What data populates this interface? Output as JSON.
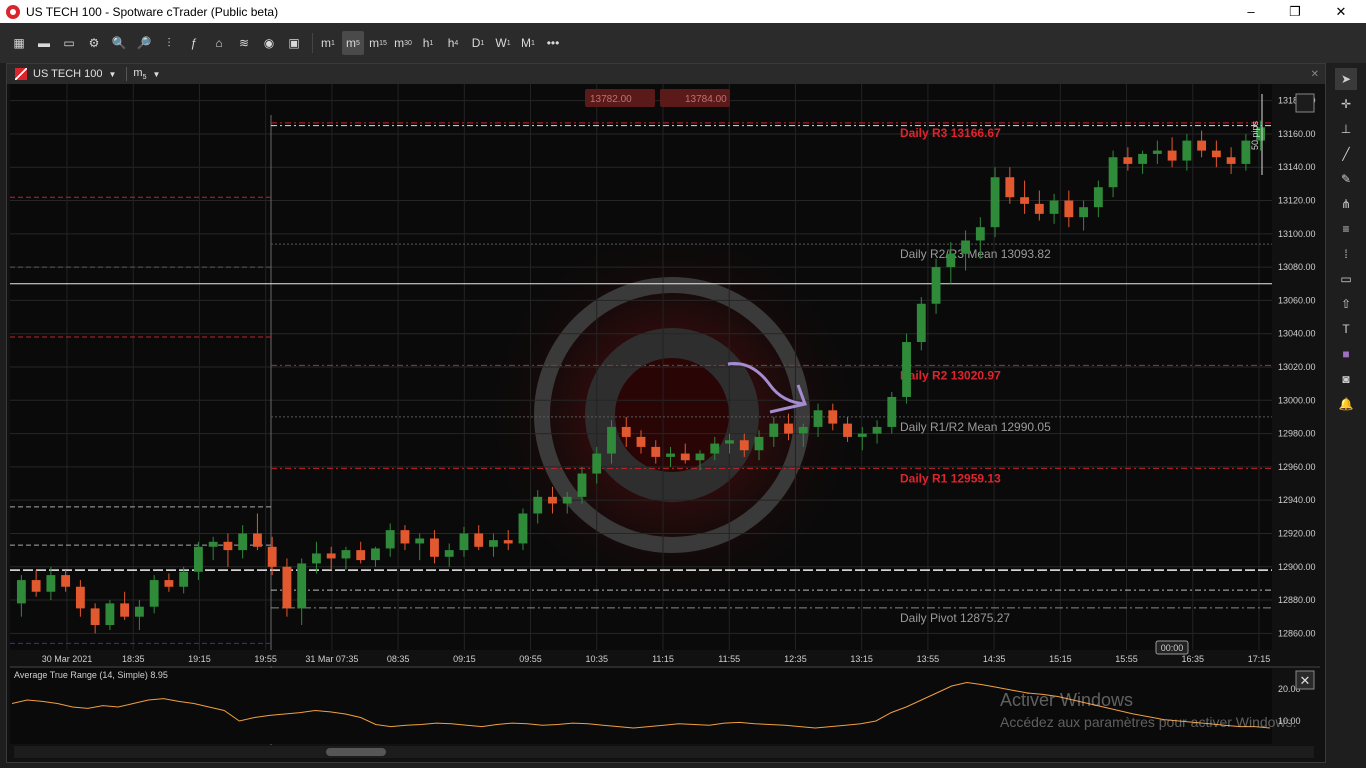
{
  "window": {
    "title": "US TECH 100 - Spotware cTrader (Public beta)",
    "minimize": "–",
    "maximize": "❐",
    "close": "✕"
  },
  "toolbar": {
    "icons": [
      "layout-icon",
      "single-chart-icon",
      "multi-chart-icon",
      "chart-settings-icon",
      "zoom-in-icon",
      "zoom-out-icon",
      "chart-type-icon",
      "indicators-icon",
      "cbots-icon",
      "layers-icon",
      "eye-icon",
      "chart-screenshot-icon"
    ],
    "timeframes": [
      {
        "label": "m",
        "sub": "1"
      },
      {
        "label": "m",
        "sub": "5",
        "active": true
      },
      {
        "label": "m",
        "sub": "15"
      },
      {
        "label": "m",
        "sub": "30"
      },
      {
        "label": "h",
        "sub": "1"
      },
      {
        "label": "h",
        "sub": "4"
      },
      {
        "label": "D",
        "sub": "1"
      },
      {
        "label": "W",
        "sub": "1"
      },
      {
        "label": "M",
        "sub": "1"
      }
    ],
    "more": "•••"
  },
  "chart_tab": {
    "symbol": "US TECH 100",
    "timeframe": "m",
    "timeframe_sub": "5",
    "close_icon": "✕"
  },
  "quote": {
    "sell": "13782.00",
    "buy": "13784.00"
  },
  "pips_label": "50 pips",
  "indicator_label": "Average True Range (14, Simple) 8.95",
  "cursor_time_label": "00:00",
  "watermark": {
    "line1": "Activer Windows",
    "line2": "Accédez aux paramètres pour activer Windows."
  },
  "colors": {
    "bull": "#2f8a3a",
    "bear": "#e2582f",
    "pivot_red": "#e0242e",
    "atr": "#f0a040"
  },
  "chart_data": {
    "type": "candlestick",
    "price_axis": {
      "ylim": [
        12850,
        13190
      ],
      "ticks": [
        13180,
        13160,
        13140,
        13120,
        13100,
        13080,
        13060,
        13040,
        13020,
        13000,
        12980,
        12960,
        12940,
        12920,
        12900,
        12880,
        12860
      ]
    },
    "time_labels": [
      "30 Mar 2021",
      "18:35",
      "19:15",
      "19:55",
      "31 Mar 07:35",
      "08:35",
      "09:15",
      "09:55",
      "10:35",
      "11:15",
      "11:55",
      "12:35",
      "13:15",
      "13:55",
      "14:35",
      "15:15",
      "15:55",
      "16:35",
      "17:15"
    ],
    "pivot_levels": [
      {
        "label": "Daily R3 13166.67",
        "value": 13166.67,
        "kind": "r"
      },
      {
        "label": "Daily R2/R3 Mean 13093.82",
        "value": 13093.82,
        "kind": "mean"
      },
      {
        "label": "Daily R2 13020.97",
        "value": 13020.97,
        "kind": "r"
      },
      {
        "label": "Daily R1/R2 Mean 12990.05",
        "value": 12990.05,
        "kind": "mean"
      },
      {
        "label": "Daily R1 12959.13",
        "value": 12959.13,
        "kind": "r"
      },
      {
        "label": "Daily Pivot 12875.27",
        "value": 12875.27,
        "kind": "pivot"
      }
    ],
    "candles": [
      [
        12878,
        12895,
        12870,
        12892
      ],
      [
        12892,
        12898,
        12882,
        12885
      ],
      [
        12885,
        12900,
        12880,
        12895
      ],
      [
        12895,
        12898,
        12885,
        12888
      ],
      [
        12888,
        12892,
        12870,
        12875
      ],
      [
        12875,
        12878,
        12860,
        12865
      ],
      [
        12865,
        12880,
        12862,
        12878
      ],
      [
        12878,
        12885,
        12868,
        12870
      ],
      [
        12870,
        12880,
        12862,
        12876
      ],
      [
        12876,
        12895,
        12872,
        12892
      ],
      [
        12892,
        12896,
        12885,
        12888
      ],
      [
        12888,
        12900,
        12884,
        12897
      ],
      [
        12897,
        12915,
        12892,
        12912
      ],
      [
        12912,
        12918,
        12904,
        12915
      ],
      [
        12915,
        12920,
        12900,
        12910
      ],
      [
        12910,
        12925,
        12905,
        12920
      ],
      [
        12920,
        12932,
        12910,
        12912
      ],
      [
        12912,
        12918,
        12895,
        12900
      ],
      [
        12900,
        12905,
        12870,
        12875
      ],
      [
        12875,
        12905,
        12865,
        12902
      ],
      [
        12902,
        12915,
        12896,
        12908
      ],
      [
        12908,
        12912,
        12898,
        12905
      ],
      [
        12905,
        12912,
        12898,
        12910
      ],
      [
        12910,
        12915,
        12902,
        12904
      ],
      [
        12904,
        12912,
        12900,
        12911
      ],
      [
        12911,
        12926,
        12906,
        12922
      ],
      [
        12922,
        12925,
        12910,
        12914
      ],
      [
        12914,
        12920,
        12904,
        12917
      ],
      [
        12917,
        12922,
        12902,
        12906
      ],
      [
        12906,
        12914,
        12900,
        12910
      ],
      [
        12910,
        12924,
        12906,
        12920
      ],
      [
        12920,
        12925,
        12910,
        12912
      ],
      [
        12912,
        12920,
        12906,
        12916
      ],
      [
        12916,
        12922,
        12910,
        12914
      ],
      [
        12914,
        12935,
        12910,
        12932
      ],
      [
        12932,
        12946,
        12926,
        12942
      ],
      [
        12942,
        12948,
        12932,
        12938
      ],
      [
        12938,
        12945,
        12932,
        12942
      ],
      [
        12942,
        12960,
        12938,
        12956
      ],
      [
        12956,
        12972,
        12950,
        12968
      ],
      [
        12968,
        12988,
        12962,
        12984
      ],
      [
        12984,
        12990,
        12972,
        12978
      ],
      [
        12978,
        12982,
        12968,
        12972
      ],
      [
        12972,
        12976,
        12962,
        12966
      ],
      [
        12966,
        12972,
        12960,
        12968
      ],
      [
        12968,
        12974,
        12962,
        12964
      ],
      [
        12964,
        12970,
        12958,
        12968
      ],
      [
        12968,
        12978,
        12964,
        12974
      ],
      [
        12974,
        12980,
        12968,
        12976
      ],
      [
        12976,
        12980,
        12966,
        12970
      ],
      [
        12970,
        12982,
        12964,
        12978
      ],
      [
        12978,
        12990,
        12972,
        12986
      ],
      [
        12986,
        12992,
        12976,
        12980
      ],
      [
        12980,
        12986,
        12972,
        12984
      ],
      [
        12984,
        12998,
        12978,
        12994
      ],
      [
        12994,
        12998,
        12982,
        12986
      ],
      [
        12986,
        12990,
        12975,
        12978
      ],
      [
        12978,
        12984,
        12970,
        12980
      ],
      [
        12980,
        12988,
        12974,
        12984
      ],
      [
        12984,
        13005,
        12980,
        13002
      ],
      [
        13002,
        13040,
        12998,
        13035
      ],
      [
        13035,
        13062,
        13030,
        13058
      ],
      [
        13058,
        13085,
        13052,
        13080
      ],
      [
        13080,
        13095,
        13070,
        13088
      ],
      [
        13088,
        13102,
        13078,
        13096
      ],
      [
        13096,
        13110,
        13085,
        13104
      ],
      [
        13104,
        13140,
        13098,
        13134
      ],
      [
        13134,
        13140,
        13118,
        13122
      ],
      [
        13122,
        13132,
        13112,
        13118
      ],
      [
        13118,
        13126,
        13108,
        13112
      ],
      [
        13112,
        13124,
        13106,
        13120
      ],
      [
        13120,
        13126,
        13104,
        13110
      ],
      [
        13110,
        13120,
        13102,
        13116
      ],
      [
        13116,
        13132,
        13110,
        13128
      ],
      [
        13128,
        13150,
        13122,
        13146
      ],
      [
        13146,
        13152,
        13138,
        13142
      ],
      [
        13142,
        13150,
        13136,
        13148
      ],
      [
        13148,
        13156,
        13142,
        13150
      ],
      [
        13150,
        13158,
        13140,
        13144
      ],
      [
        13144,
        13160,
        13138,
        13156
      ],
      [
        13156,
        13162,
        13146,
        13150
      ],
      [
        13150,
        13156,
        13140,
        13146
      ],
      [
        13146,
        13152,
        13136,
        13142
      ],
      [
        13142,
        13160,
        13138,
        13156
      ],
      [
        13156,
        13168,
        13150,
        13164
      ]
    ],
    "atr_series": [
      0.55,
      0.6,
      0.58,
      0.55,
      0.5,
      0.48,
      0.52,
      0.5,
      0.55,
      0.6,
      0.62,
      0.58,
      0.55,
      0.5,
      0.45,
      0.3,
      0.35,
      0.38,
      0.4,
      0.42,
      0.45,
      0.43,
      0.4,
      0.35,
      0.25,
      0.22,
      0.24,
      0.25,
      0.27,
      0.26,
      0.24,
      0.22,
      0.25,
      0.27,
      0.26,
      0.24,
      0.25,
      0.27,
      0.26,
      0.24,
      0.22,
      0.2,
      0.22,
      0.24,
      0.26,
      0.25,
      0.24,
      0.27,
      0.28,
      0.26,
      0.25,
      0.24,
      0.22,
      0.2,
      0.22,
      0.24,
      0.26,
      0.3,
      0.42,
      0.5,
      0.6,
      0.7,
      0.8,
      0.85,
      0.82,
      0.78,
      0.74,
      0.7,
      0.68,
      0.65,
      0.6,
      0.55,
      0.5,
      0.45,
      0.4,
      0.36,
      0.32,
      0.3,
      0.28,
      0.26,
      0.24,
      0.22,
      0.22,
      0.2
    ],
    "atr_axis_ticks": [
      "20.00",
      "10.00"
    ]
  }
}
